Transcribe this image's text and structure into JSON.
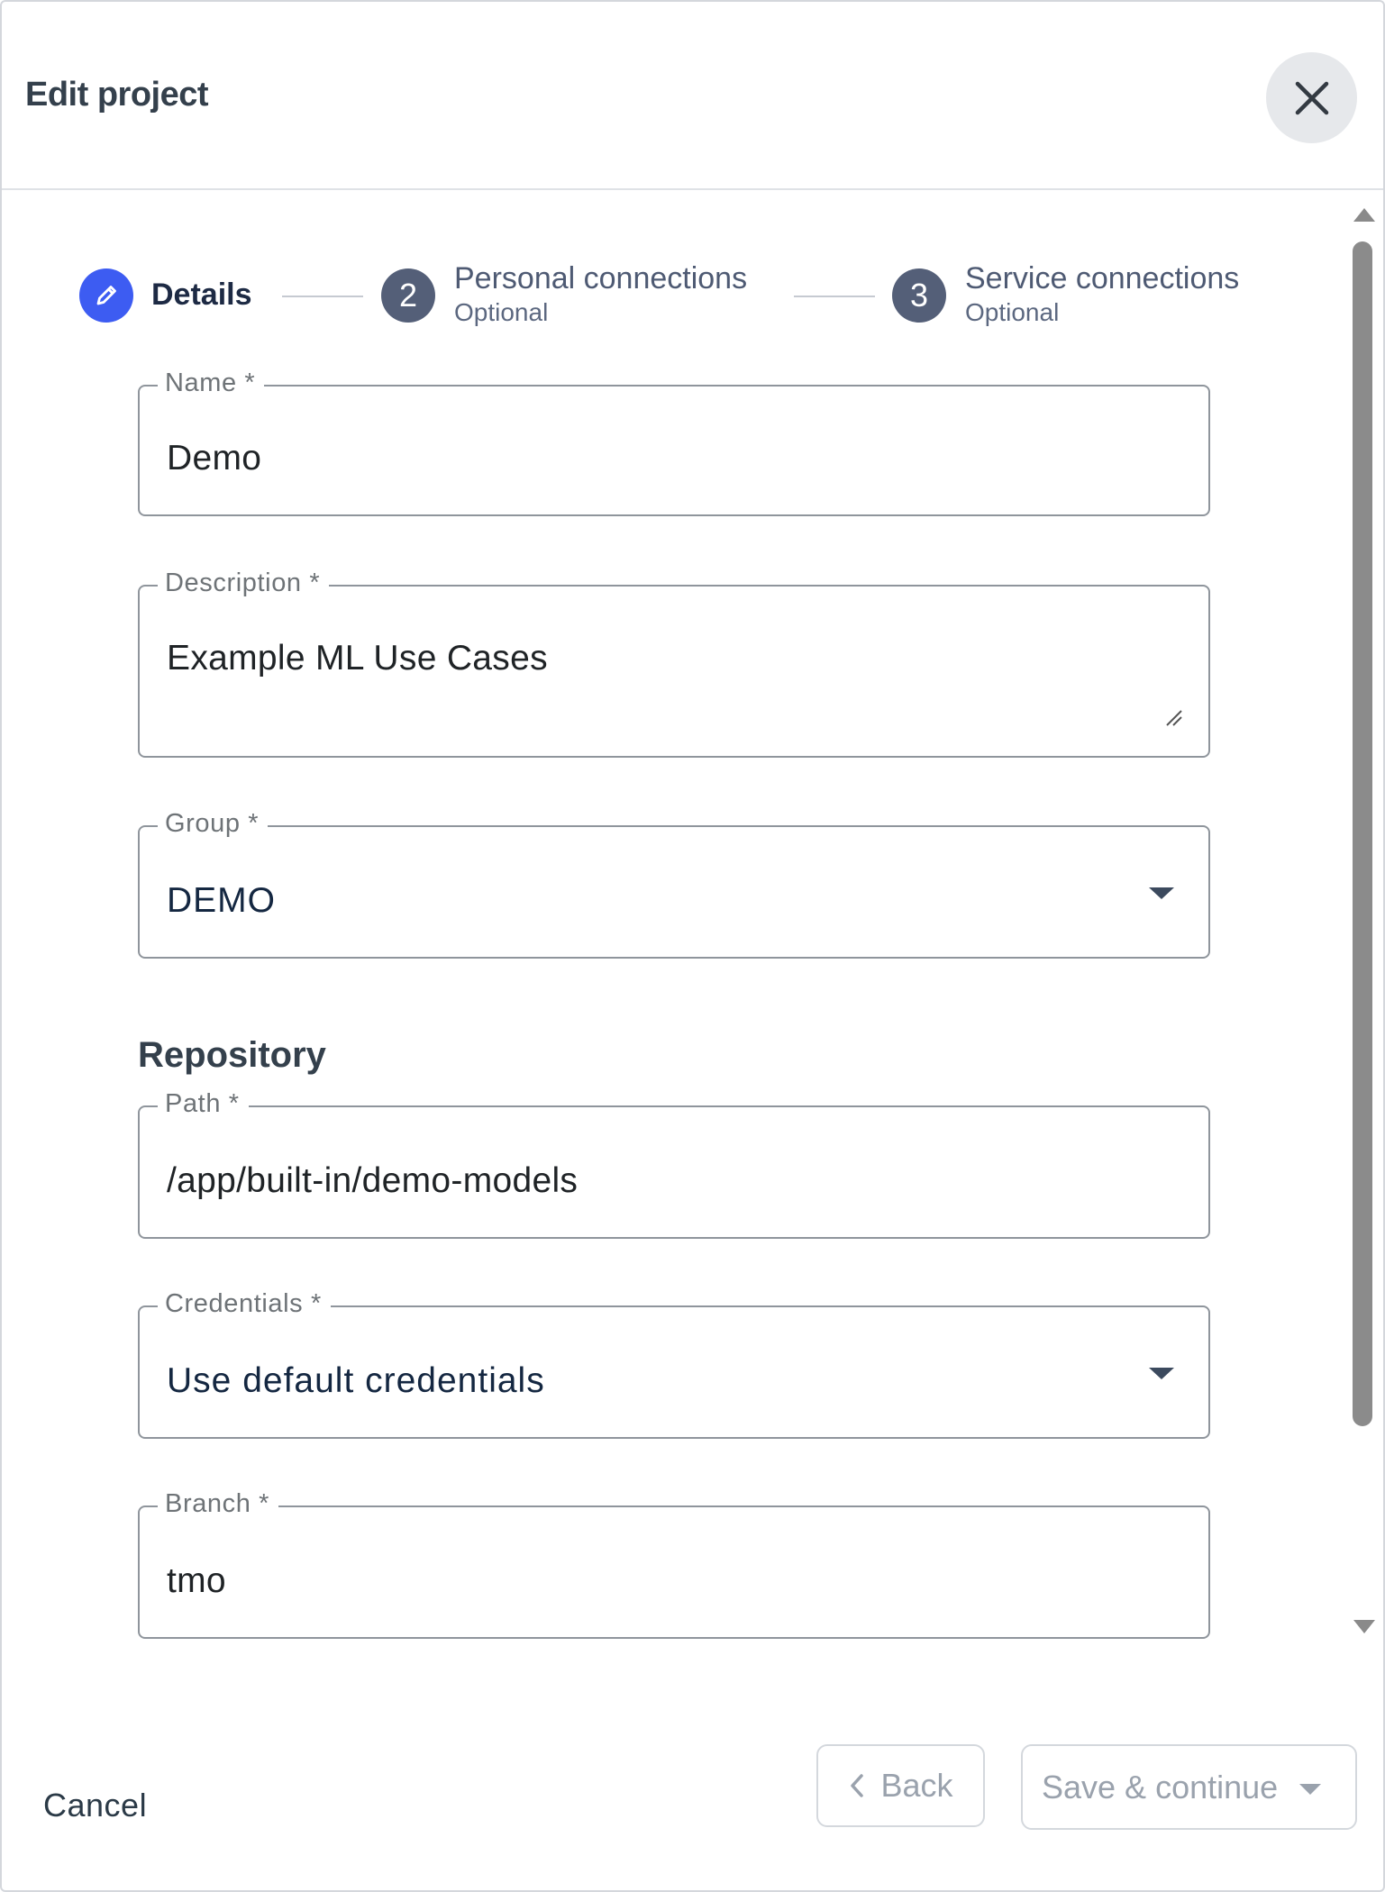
{
  "dialog": {
    "title": "Edit project",
    "close_icon": "close-icon"
  },
  "stepper": {
    "steps": [
      {
        "label": "Details",
        "marker": "",
        "icon": "pencil-icon",
        "state": "active"
      },
      {
        "label": "Personal connections",
        "marker": "2",
        "sublabel": "Optional",
        "state": "inactive"
      },
      {
        "label": "Service connections",
        "marker": "3",
        "sublabel": "Optional",
        "state": "inactive"
      }
    ]
  },
  "form": {
    "name": {
      "label": "Name *",
      "value": "Demo"
    },
    "description": {
      "label": "Description *",
      "value": "Example ML Use Cases"
    },
    "group": {
      "label": "Group *",
      "value": "DEMO"
    },
    "repository_title": "Repository",
    "path": {
      "label": "Path *",
      "value": "/app/built-in/demo-models"
    },
    "credentials": {
      "label": "Credentials *",
      "value": "Use default credentials"
    },
    "branch": {
      "label": "Branch *",
      "value": "tmo"
    }
  },
  "footer": {
    "cancel_label": "Cancel",
    "back_label": "Back",
    "save_label": "Save & continue"
  },
  "colors": {
    "accent": "#3d5cf2",
    "step_inactive": "#545f78",
    "disabled_text": "#9aa2ad"
  }
}
